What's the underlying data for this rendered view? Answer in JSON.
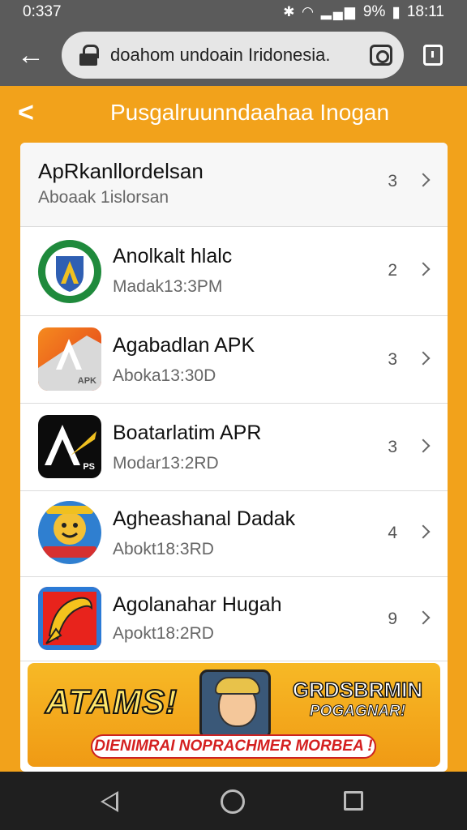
{
  "status": {
    "time_left": "0:337",
    "battery": "9%",
    "clock": "18:11"
  },
  "browser": {
    "url": "doahom  undoain Iridonesia."
  },
  "header": {
    "title": "Pusgalruunndaahaa Inogan"
  },
  "list": {
    "header_row": {
      "title": "ApRkanllordelsan",
      "subtitle": "Aboaak 1islorsan",
      "count": "3"
    },
    "items": [
      {
        "title": "Anolkalt hlalc",
        "subtitle": "Madak13:3PM",
        "count": "2",
        "icon": "shield-a-icon"
      },
      {
        "title": "Agabadlan APK",
        "subtitle": "Aboka13:30D",
        "count": "3",
        "icon": "orange-a-apk-icon"
      },
      {
        "title": "Boatarlatim APR",
        "subtitle": "Modar13:2RD",
        "count": "3",
        "icon": "black-a-icon"
      },
      {
        "title": "Agheashanal Dadak",
        "subtitle": "Abokt18:3RD",
        "count": "4",
        "icon": "mascot-icon"
      },
      {
        "title": "Agolanahar Hugah",
        "subtitle": "Apokt18:2RD",
        "count": "9",
        "icon": "yellow-swirl-icon"
      }
    ],
    "apk_label": "APK",
    "ps_label": "PS"
  },
  "banner": {
    "left_text": "ATAMS!",
    "right_line1": "GRDSBRMIN",
    "right_line2": "POGAGNAR!",
    "cta": "DIENIMRAI NOPRACHMER MORBEA !"
  },
  "colors": {
    "accent": "#f2a21b",
    "chrome": "#5b5b5b",
    "navbar": "#1f1f1f"
  }
}
